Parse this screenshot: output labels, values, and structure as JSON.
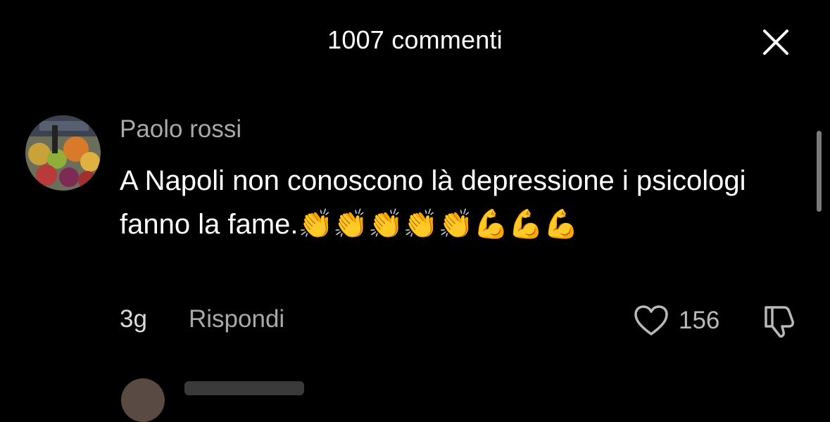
{
  "header": {
    "title": "1007 commenti",
    "close_icon": "close-icon"
  },
  "comment": {
    "username": "Paolo rossi",
    "text": "A Napoli non conoscono là depressione i psicologi fanno la fame.",
    "emojis": "👏👏👏👏👏💪💪💪",
    "time": "3g",
    "reply_label": "Rispondi",
    "like_count": "156",
    "like_icon": "heart-icon",
    "dislike_icon": "thumbs-down-icon"
  },
  "colors": {
    "background": "#000000",
    "username": "#a9a9a9",
    "text": "#ffffff",
    "meta": "#a9a9a9"
  }
}
